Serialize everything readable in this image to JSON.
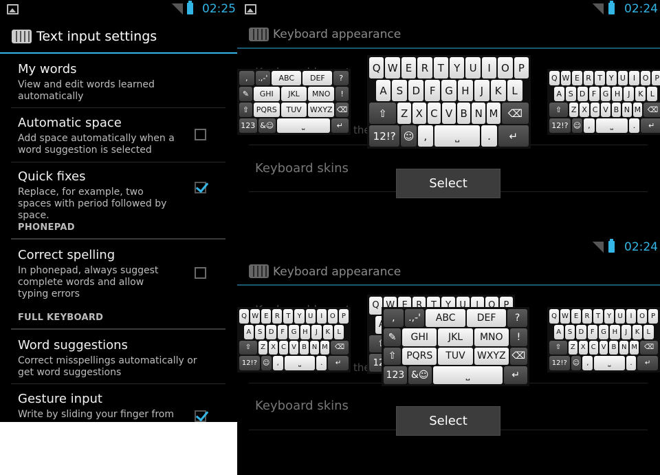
{
  "left": {
    "time": "02:25",
    "title": "Text input settings",
    "prefs": [
      {
        "title": "My words",
        "summary": "View and edit words learned automatically"
      },
      {
        "title": "Automatic space",
        "summary": "Add space automatically when a word suggestion is selected"
      },
      {
        "title": "Quick fixes",
        "summary": "Replace, for example, two spaces with period followed by space."
      },
      {
        "title": "Correct spelling",
        "summary": "In phonepad, always suggest complete words and allow typing errors"
      },
      {
        "title": "Word suggestions",
        "summary": "Correct misspellings automatically or get word suggestions"
      },
      {
        "title": "Gesture input",
        "summary": "Write by sliding your finger from"
      }
    ],
    "categories": [
      "PHONEPAD",
      "FULL KEYBOARD"
    ],
    "checkboxes": {
      "automatic_space": false,
      "quick_fixes": true,
      "correct_spelling": false,
      "gesture_input": true
    }
  },
  "right_top": {
    "time": "02:24",
    "appearance": "Keyboard appearance",
    "behind_title": "Keyboard layout",
    "behind_sub": "the",
    "skins": "Keyboard skins",
    "select": "Select"
  },
  "right_bottom": {
    "time": "02:24",
    "appearance": "Keyboard appearance",
    "behind_title": "Keyboard layout",
    "behind_sub": "the",
    "skins": "Keyboard skins",
    "select": "Select"
  },
  "keyboards": {
    "qwerty": [
      [
        "Q",
        "W",
        "E",
        "R",
        "T",
        "Y",
        "U",
        "I",
        "O",
        "P"
      ],
      [
        "A",
        "S",
        "D",
        "F",
        "G",
        "H",
        "J",
        "K",
        "L"
      ],
      [
        "⇧",
        "Z",
        "X",
        "C",
        "V",
        "B",
        "N",
        "M",
        "⌫"
      ],
      [
        "12!?",
        "☺",
        ",",
        "⎵",
        ".",
        "↵"
      ]
    ],
    "phonepad": [
      [
        ",",
        ".,-'",
        "ABC",
        "DEF",
        "?"
      ],
      [
        "✎",
        "GHI",
        "JKL",
        "MNO",
        "!"
      ],
      [
        "⇧",
        "PQRS",
        "TUV",
        "WXYZ",
        "⌫"
      ],
      [
        "123",
        "&☺",
        "⎵",
        "↵"
      ]
    ]
  },
  "colors": {
    "accent": "#33b5e5",
    "background": "#000000",
    "key": "#e8e8e8",
    "dark_key": "#4a4a4a"
  }
}
